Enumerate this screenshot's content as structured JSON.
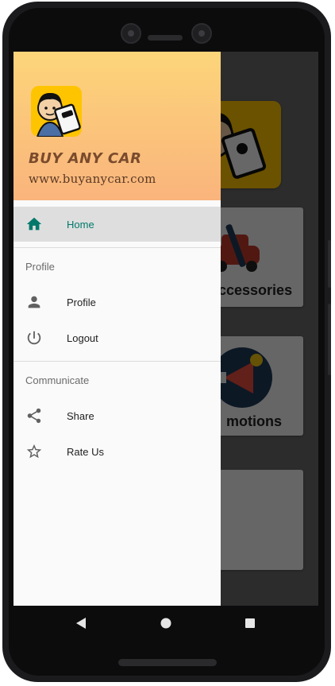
{
  "drawer": {
    "brand_title": "BUY ANY CAR",
    "brand_url": "www.buyanycar.com",
    "items": [
      {
        "label": "Home",
        "icon": "home-icon",
        "active": true
      },
      {
        "label": "Profile",
        "icon": "person-icon",
        "active": false
      },
      {
        "label": "Logout",
        "icon": "power-icon",
        "active": false
      },
      {
        "label": "Share",
        "icon": "share-icon",
        "active": false
      },
      {
        "label": "Rate Us",
        "icon": "star-icon",
        "active": false
      }
    ],
    "sections": {
      "profile": "Profile",
      "communicate": "Communicate"
    }
  },
  "background": {
    "cards": [
      {
        "label": "ccessories"
      },
      {
        "label": "motions"
      }
    ]
  },
  "colors": {
    "accent": "#00796b",
    "header_start": "#fcd57a",
    "header_end": "#fab47c"
  },
  "system_nav": {
    "back": "back-icon",
    "home": "home-circle-icon",
    "recents": "recents-icon"
  }
}
